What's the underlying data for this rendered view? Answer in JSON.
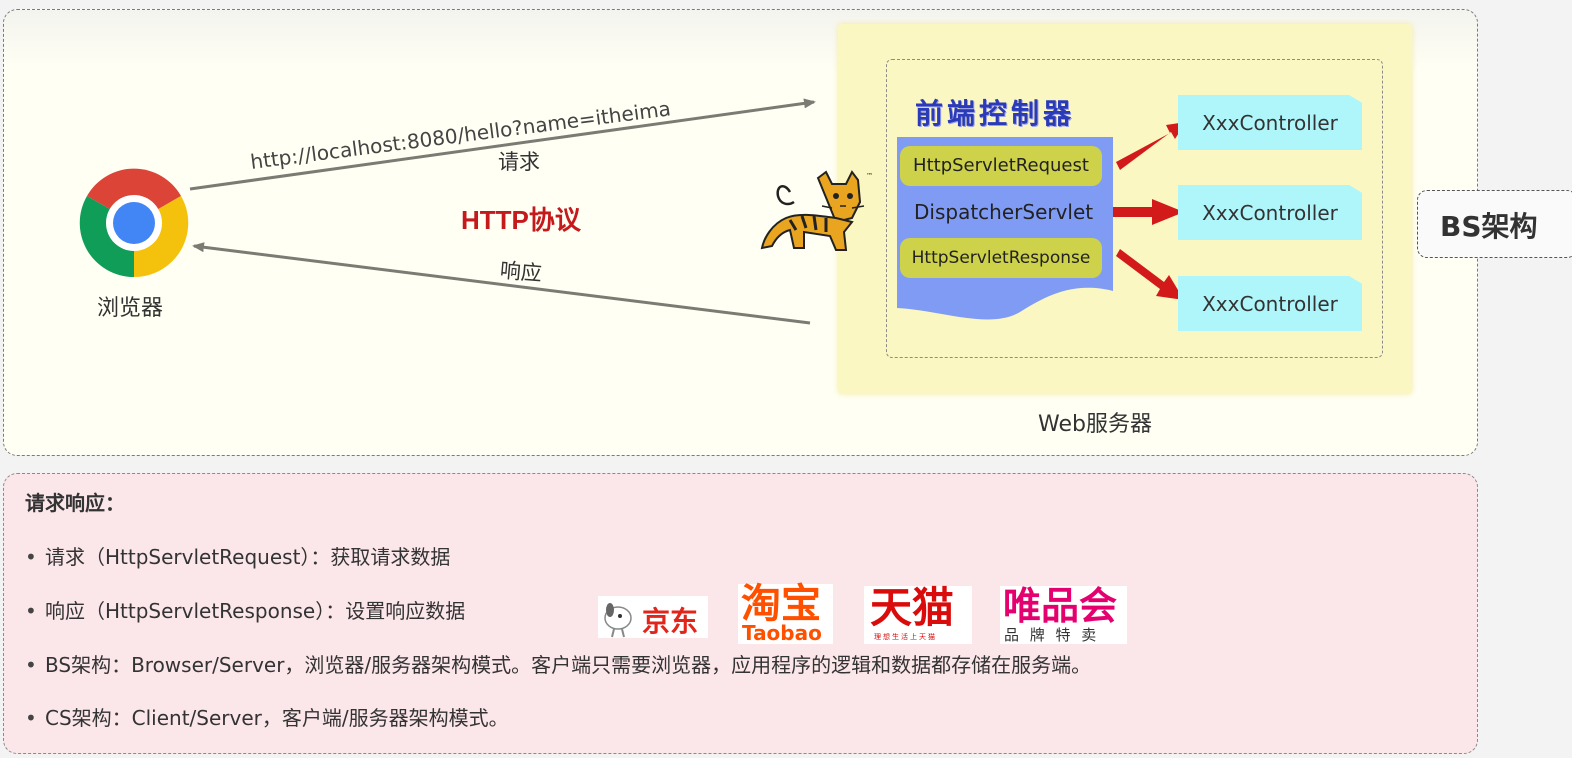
{
  "diagram": {
    "browser_label": "浏览器",
    "url": "http://localhost:8080/hello?name=itheima",
    "request_label": "请求",
    "protocol_label": "HTTP协议",
    "response_label": "响应",
    "front_controller_title": "前端控制器",
    "request_object": "HttpServletRequest",
    "dispatcher": "DispatcherServlet",
    "response_object": "HttpServletResponse",
    "controllers": [
      "XxxController",
      "XxxController",
      "XxxController"
    ],
    "web_server_label": "Web服务器",
    "architecture_badge": "BS架构"
  },
  "notes": {
    "title": "请求响应：",
    "bullets": [
      "请求（HttpServletRequest）：获取请求数据",
      "响应（HttpServletResponse）：设置响应数据",
      "BS架构：Browser/Server，浏览器/服务器架构模式。客户端只需要浏览器，应用程序的逻辑和数据都存储在服务端。",
      "CS架构：Client/Server，客户端/服务器架构模式。"
    ],
    "bullet_glyph": "•"
  },
  "logos": {
    "jd": "京东",
    "taobao_cn": "淘宝",
    "taobao_en": "Taobao",
    "tmall": "天猫",
    "tmall_sub": "理想生活上天猫",
    "vip": "唯品会",
    "vip_sub": "品 牌 特 卖"
  },
  "colors": {
    "http_red": "#c5191c",
    "dispatcher_blue": "#7f9bf4",
    "label_olive": "#cdd24a",
    "controller_cyan": "#aff6fb",
    "arrow_red": "#d31a1a",
    "server_yellow": "#fbf7c3",
    "notes_pink": "#fbe6ea"
  },
  "icons": [
    "chrome-icon",
    "tomcat-icon"
  ]
}
